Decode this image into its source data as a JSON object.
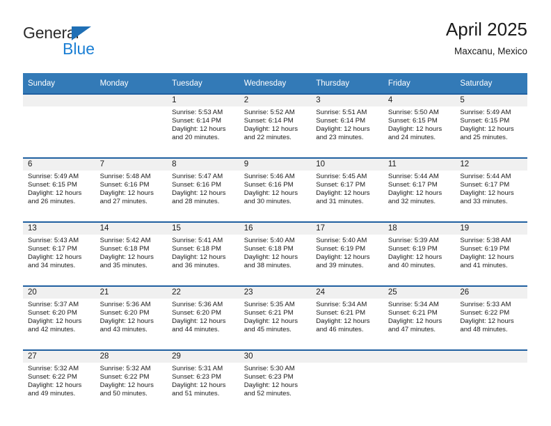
{
  "brand": {
    "name_part1": "General",
    "name_part2": "Blue",
    "triangle_icon": "triangle-icon",
    "color_dark": "#2b2b2b",
    "color_blue": "#1b7fd4",
    "color_triangle": "#1f6fb5"
  },
  "header": {
    "title": "April 2025",
    "subtitle": "Maxcanu, Mexico"
  },
  "theme": {
    "header_bg": "#337ab7",
    "header_text": "#ffffff",
    "rule_color": "#1f5fa0",
    "daynum_band_bg": "#f0f0f0",
    "cell_bg": "#ffffff",
    "body_text": "#1a1a1a"
  },
  "calendar": {
    "weekday_headers": [
      "Sunday",
      "Monday",
      "Tuesday",
      "Wednesday",
      "Thursday",
      "Friday",
      "Saturday"
    ],
    "weeks": [
      [
        {
          "day": "",
          "sunrise": "",
          "sunset": "",
          "daylight_line1": "",
          "daylight_line2": ""
        },
        {
          "day": "",
          "sunrise": "",
          "sunset": "",
          "daylight_line1": "",
          "daylight_line2": ""
        },
        {
          "day": "1",
          "sunrise": "Sunrise: 5:53 AM",
          "sunset": "Sunset: 6:14 PM",
          "daylight_line1": "Daylight: 12 hours",
          "daylight_line2": "and 20 minutes."
        },
        {
          "day": "2",
          "sunrise": "Sunrise: 5:52 AM",
          "sunset": "Sunset: 6:14 PM",
          "daylight_line1": "Daylight: 12 hours",
          "daylight_line2": "and 22 minutes."
        },
        {
          "day": "3",
          "sunrise": "Sunrise: 5:51 AM",
          "sunset": "Sunset: 6:14 PM",
          "daylight_line1": "Daylight: 12 hours",
          "daylight_line2": "and 23 minutes."
        },
        {
          "day": "4",
          "sunrise": "Sunrise: 5:50 AM",
          "sunset": "Sunset: 6:15 PM",
          "daylight_line1": "Daylight: 12 hours",
          "daylight_line2": "and 24 minutes."
        },
        {
          "day": "5",
          "sunrise": "Sunrise: 5:49 AM",
          "sunset": "Sunset: 6:15 PM",
          "daylight_line1": "Daylight: 12 hours",
          "daylight_line2": "and 25 minutes."
        }
      ],
      [
        {
          "day": "6",
          "sunrise": "Sunrise: 5:49 AM",
          "sunset": "Sunset: 6:15 PM",
          "daylight_line1": "Daylight: 12 hours",
          "daylight_line2": "and 26 minutes."
        },
        {
          "day": "7",
          "sunrise": "Sunrise: 5:48 AM",
          "sunset": "Sunset: 6:16 PM",
          "daylight_line1": "Daylight: 12 hours",
          "daylight_line2": "and 27 minutes."
        },
        {
          "day": "8",
          "sunrise": "Sunrise: 5:47 AM",
          "sunset": "Sunset: 6:16 PM",
          "daylight_line1": "Daylight: 12 hours",
          "daylight_line2": "and 28 minutes."
        },
        {
          "day": "9",
          "sunrise": "Sunrise: 5:46 AM",
          "sunset": "Sunset: 6:16 PM",
          "daylight_line1": "Daylight: 12 hours",
          "daylight_line2": "and 30 minutes."
        },
        {
          "day": "10",
          "sunrise": "Sunrise: 5:45 AM",
          "sunset": "Sunset: 6:17 PM",
          "daylight_line1": "Daylight: 12 hours",
          "daylight_line2": "and 31 minutes."
        },
        {
          "day": "11",
          "sunrise": "Sunrise: 5:44 AM",
          "sunset": "Sunset: 6:17 PM",
          "daylight_line1": "Daylight: 12 hours",
          "daylight_line2": "and 32 minutes."
        },
        {
          "day": "12",
          "sunrise": "Sunrise: 5:44 AM",
          "sunset": "Sunset: 6:17 PM",
          "daylight_line1": "Daylight: 12 hours",
          "daylight_line2": "and 33 minutes."
        }
      ],
      [
        {
          "day": "13",
          "sunrise": "Sunrise: 5:43 AM",
          "sunset": "Sunset: 6:17 PM",
          "daylight_line1": "Daylight: 12 hours",
          "daylight_line2": "and 34 minutes."
        },
        {
          "day": "14",
          "sunrise": "Sunrise: 5:42 AM",
          "sunset": "Sunset: 6:18 PM",
          "daylight_line1": "Daylight: 12 hours",
          "daylight_line2": "and 35 minutes."
        },
        {
          "day": "15",
          "sunrise": "Sunrise: 5:41 AM",
          "sunset": "Sunset: 6:18 PM",
          "daylight_line1": "Daylight: 12 hours",
          "daylight_line2": "and 36 minutes."
        },
        {
          "day": "16",
          "sunrise": "Sunrise: 5:40 AM",
          "sunset": "Sunset: 6:18 PM",
          "daylight_line1": "Daylight: 12 hours",
          "daylight_line2": "and 38 minutes."
        },
        {
          "day": "17",
          "sunrise": "Sunrise: 5:40 AM",
          "sunset": "Sunset: 6:19 PM",
          "daylight_line1": "Daylight: 12 hours",
          "daylight_line2": "and 39 minutes."
        },
        {
          "day": "18",
          "sunrise": "Sunrise: 5:39 AM",
          "sunset": "Sunset: 6:19 PM",
          "daylight_line1": "Daylight: 12 hours",
          "daylight_line2": "and 40 minutes."
        },
        {
          "day": "19",
          "sunrise": "Sunrise: 5:38 AM",
          "sunset": "Sunset: 6:19 PM",
          "daylight_line1": "Daylight: 12 hours",
          "daylight_line2": "and 41 minutes."
        }
      ],
      [
        {
          "day": "20",
          "sunrise": "Sunrise: 5:37 AM",
          "sunset": "Sunset: 6:20 PM",
          "daylight_line1": "Daylight: 12 hours",
          "daylight_line2": "and 42 minutes."
        },
        {
          "day": "21",
          "sunrise": "Sunrise: 5:36 AM",
          "sunset": "Sunset: 6:20 PM",
          "daylight_line1": "Daylight: 12 hours",
          "daylight_line2": "and 43 minutes."
        },
        {
          "day": "22",
          "sunrise": "Sunrise: 5:36 AM",
          "sunset": "Sunset: 6:20 PM",
          "daylight_line1": "Daylight: 12 hours",
          "daylight_line2": "and 44 minutes."
        },
        {
          "day": "23",
          "sunrise": "Sunrise: 5:35 AM",
          "sunset": "Sunset: 6:21 PM",
          "daylight_line1": "Daylight: 12 hours",
          "daylight_line2": "and 45 minutes."
        },
        {
          "day": "24",
          "sunrise": "Sunrise: 5:34 AM",
          "sunset": "Sunset: 6:21 PM",
          "daylight_line1": "Daylight: 12 hours",
          "daylight_line2": "and 46 minutes."
        },
        {
          "day": "25",
          "sunrise": "Sunrise: 5:34 AM",
          "sunset": "Sunset: 6:21 PM",
          "daylight_line1": "Daylight: 12 hours",
          "daylight_line2": "and 47 minutes."
        },
        {
          "day": "26",
          "sunrise": "Sunrise: 5:33 AM",
          "sunset": "Sunset: 6:22 PM",
          "daylight_line1": "Daylight: 12 hours",
          "daylight_line2": "and 48 minutes."
        }
      ],
      [
        {
          "day": "27",
          "sunrise": "Sunrise: 5:32 AM",
          "sunset": "Sunset: 6:22 PM",
          "daylight_line1": "Daylight: 12 hours",
          "daylight_line2": "and 49 minutes."
        },
        {
          "day": "28",
          "sunrise": "Sunrise: 5:32 AM",
          "sunset": "Sunset: 6:22 PM",
          "daylight_line1": "Daylight: 12 hours",
          "daylight_line2": "and 50 minutes."
        },
        {
          "day": "29",
          "sunrise": "Sunrise: 5:31 AM",
          "sunset": "Sunset: 6:23 PM",
          "daylight_line1": "Daylight: 12 hours",
          "daylight_line2": "and 51 minutes."
        },
        {
          "day": "30",
          "sunrise": "Sunrise: 5:30 AM",
          "sunset": "Sunset: 6:23 PM",
          "daylight_line1": "Daylight: 12 hours",
          "daylight_line2": "and 52 minutes."
        },
        {
          "day": "",
          "sunrise": "",
          "sunset": "",
          "daylight_line1": "",
          "daylight_line2": ""
        },
        {
          "day": "",
          "sunrise": "",
          "sunset": "",
          "daylight_line1": "",
          "daylight_line2": ""
        },
        {
          "day": "",
          "sunrise": "",
          "sunset": "",
          "daylight_line1": "",
          "daylight_line2": ""
        }
      ]
    ]
  }
}
